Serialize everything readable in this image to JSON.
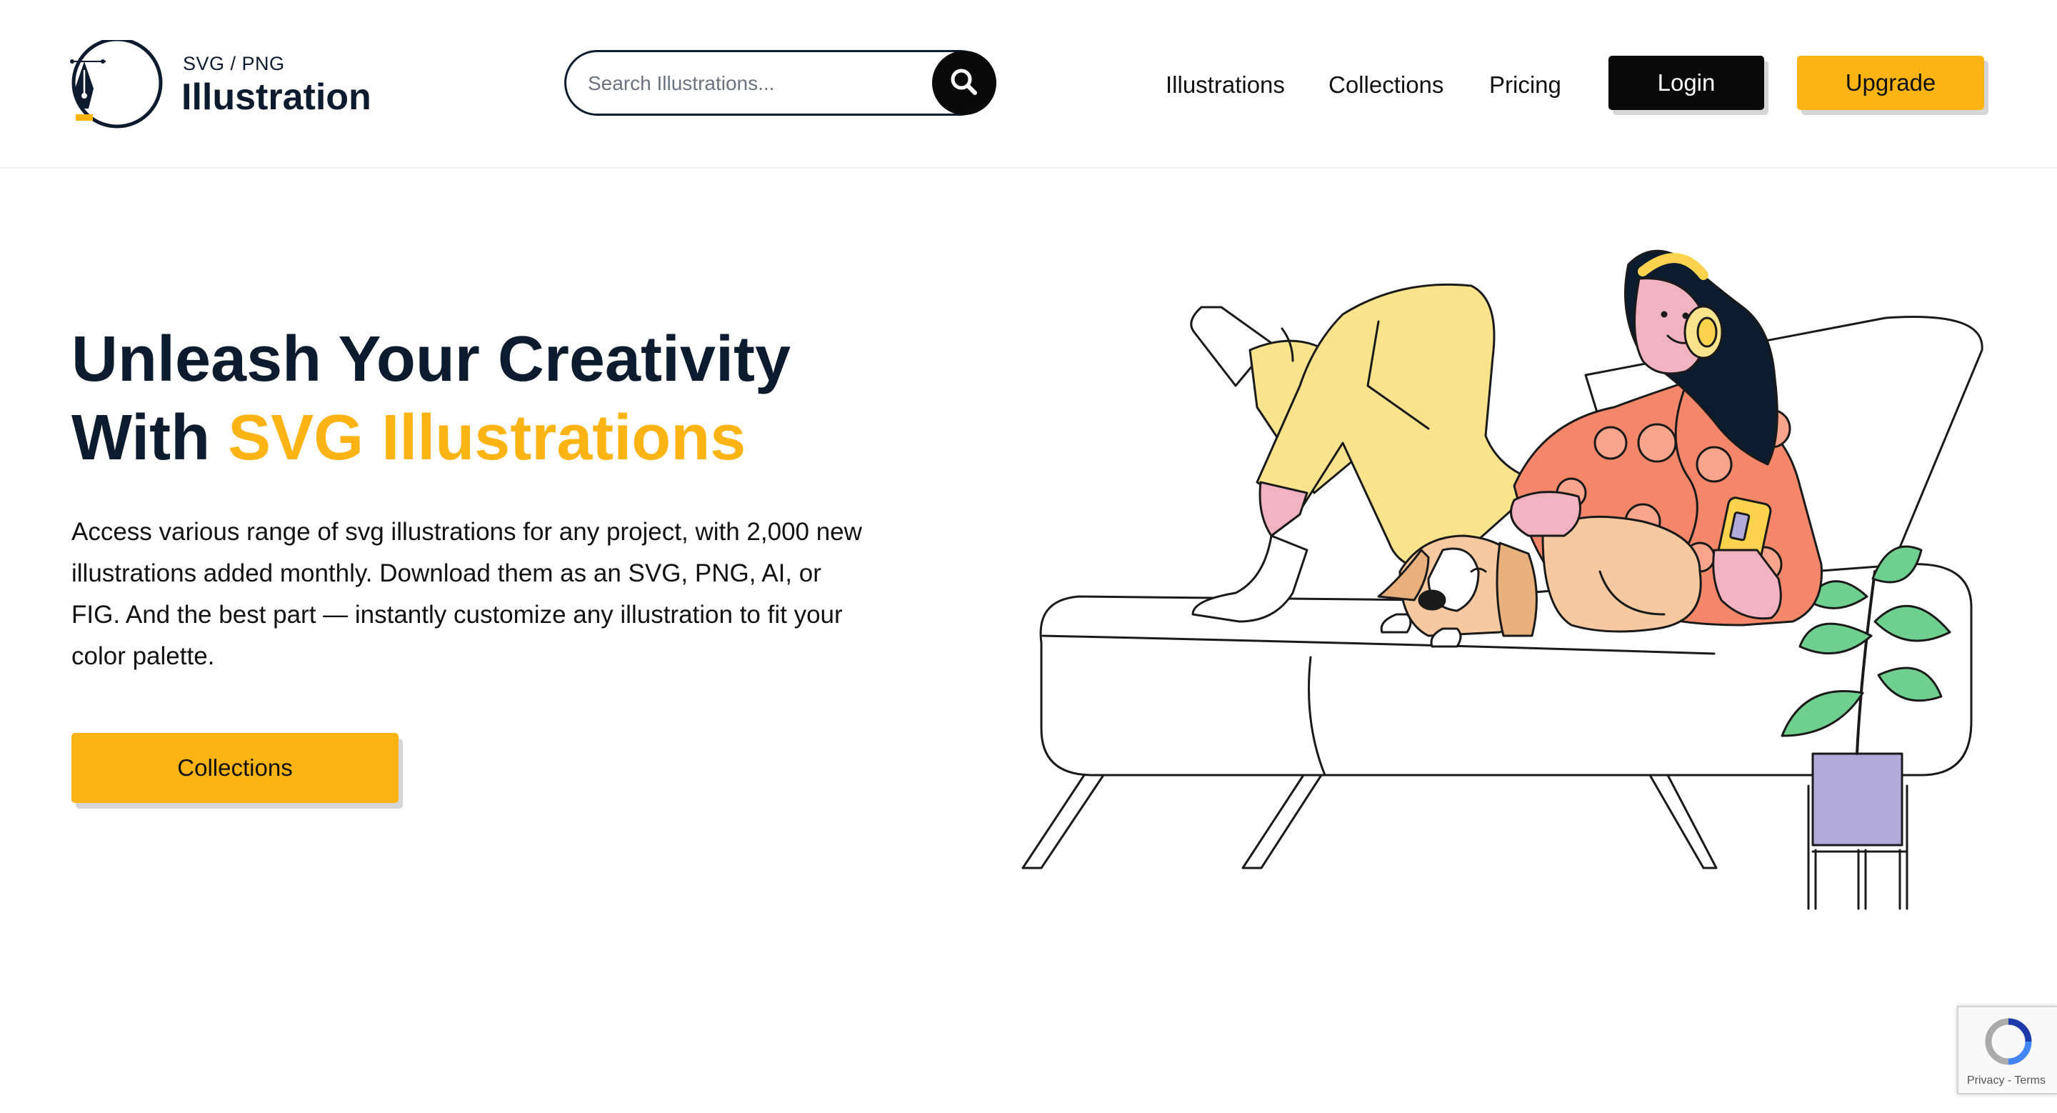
{
  "brand": {
    "subtitle": "SVG / PNG",
    "title": "Illustration"
  },
  "search": {
    "placeholder": "Search Illustrations..."
  },
  "nav": {
    "illustrations": "Illustrations",
    "collections": "Collections",
    "pricing": "Pricing",
    "login": "Login",
    "upgrade": "Upgrade"
  },
  "hero": {
    "title_line1": "Unleash Your Creativity",
    "title_line2_prefix": "With ",
    "title_line2_accent": "SVG Illustrations",
    "description": "Access various range of svg illustrations for any project, with 2,000 new illustrations added monthly. Download them as an SVG, PNG, AI, or FIG. And the best part — instantly customize any illustration to fit your color palette.",
    "cta": "Collections"
  },
  "recaptcha": {
    "privacy": "Privacy",
    "separator": " - ",
    "terms": "Terms"
  },
  "colors": {
    "navy": "#0d1b2e",
    "accent_yellow": "#fcb415",
    "black": "#0a0a0a",
    "shirt_coral": "#f4876a",
    "pants_yellow": "#f9e38c",
    "skin_pink": "#f2b3c0",
    "dog_tan": "#f7c9a0",
    "plant_green": "#6fcf8f",
    "pot_lavender": "#b2aad8"
  },
  "icons": [
    "pen-nib-logo-icon",
    "search-icon",
    "recaptcha-icon"
  ]
}
